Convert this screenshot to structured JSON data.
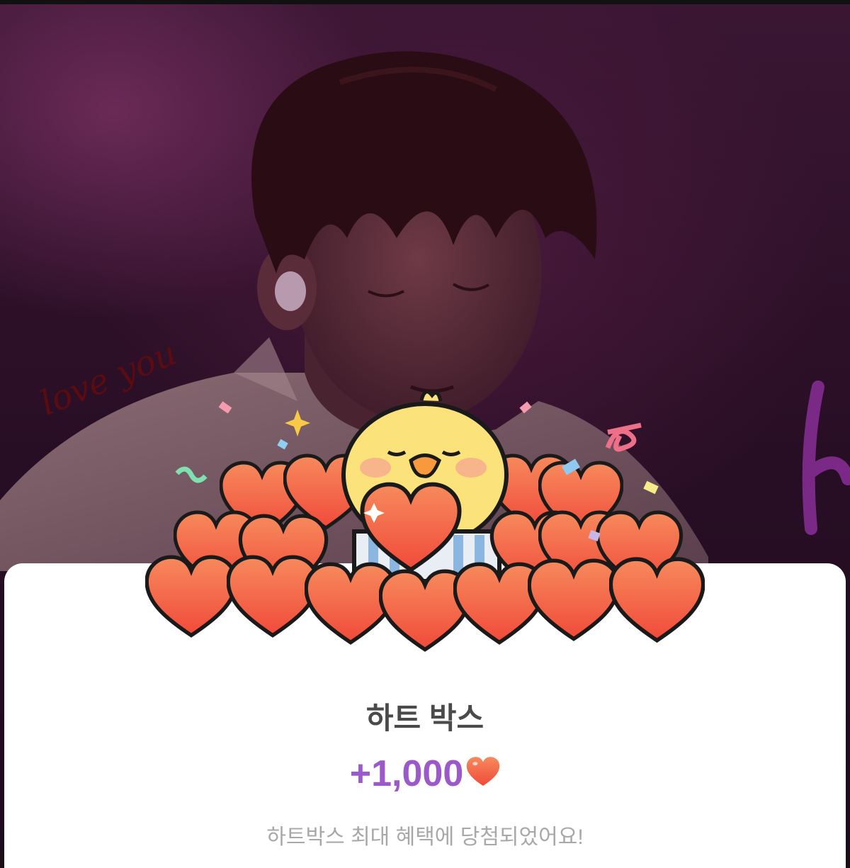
{
  "background": {
    "handwriting": "love you"
  },
  "reward": {
    "title": "하트 박스",
    "amount": "+1,000",
    "amount_icon": "heart-icon",
    "message": "하트박스 최대 혜택에 당첨되었어요!"
  },
  "colors": {
    "amount": "#9b59c9",
    "title": "#4a4a4a",
    "message": "#a8a8a8",
    "heart": "#f25a3c"
  }
}
